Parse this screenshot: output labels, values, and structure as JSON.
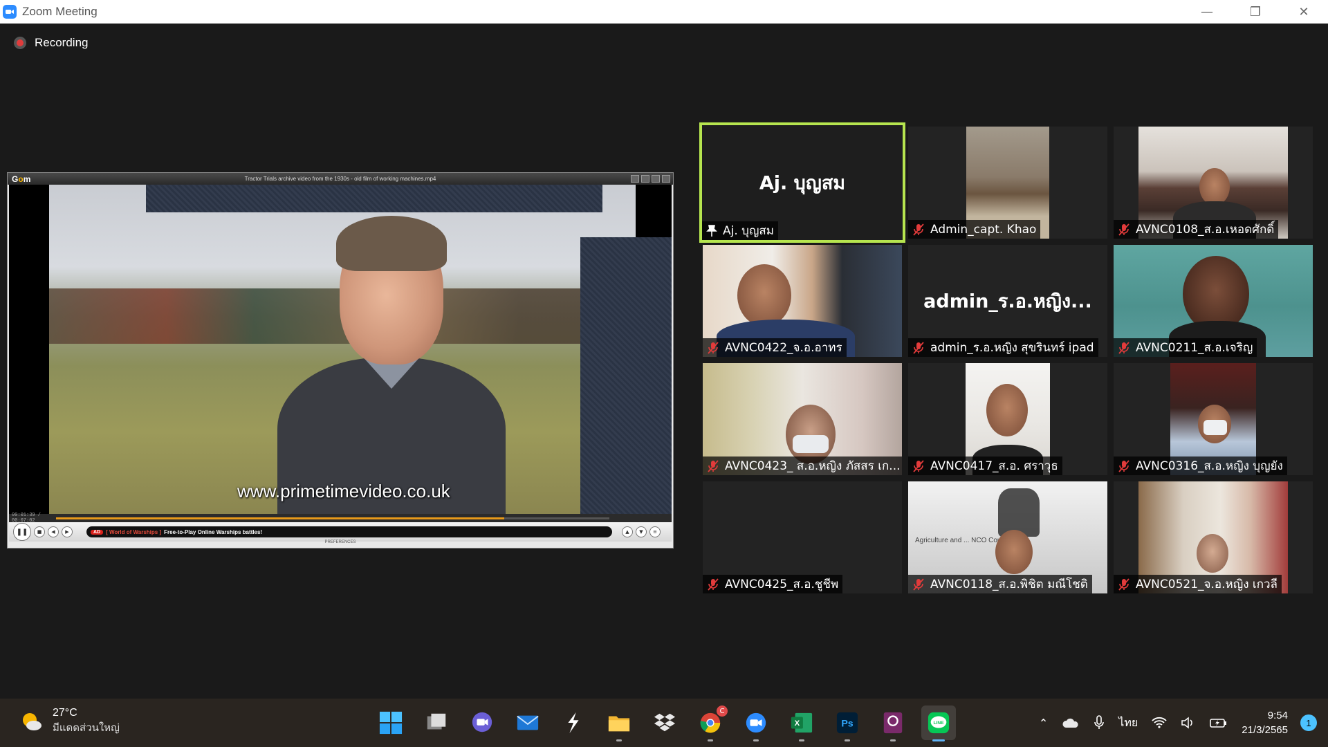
{
  "window": {
    "title": "Zoom Meeting",
    "minimize": "—",
    "restore": "❐",
    "close": "✕"
  },
  "recording": {
    "label": "Recording"
  },
  "shared_screen": {
    "player_logo_a": "G",
    "player_logo_b": "o",
    "player_logo_c": "m",
    "title": "Tractor Trials archive video from the 1930s - old film of working machines.mp4",
    "watermark": "www.primetimevideo.co.uk",
    "time": "00:01:39 / 00:07:02",
    "progress": 0.81,
    "ad_badge": "AD",
    "ad_title": "[ World of Warships ]",
    "ad_text": "Free-to-Play Online Warships battles!",
    "preferences": "PREFERENCES"
  },
  "participants": [
    {
      "display_text": "Aj. บุญสม",
      "name": "Aj. บุญสม",
      "pinned": true,
      "active_speaker": true
    },
    {
      "name": "Admin_capt. Khao",
      "muted": true
    },
    {
      "name": "AVNC0108_ส.อ.เหอดศักดิ์",
      "muted": true
    },
    {
      "name": "AVNC0422_จ.อ.อาทร",
      "muted": true
    },
    {
      "display_text": "admin_ร.อ.หญิง...",
      "name": "admin_ร.อ.หญิง สุขรินทร์ ipad",
      "muted": true
    },
    {
      "name": "AVNC0211_ส.อ.เจริญ",
      "muted": true
    },
    {
      "name": "AVNC0423_ ส.อ.หญิง ภัสสร เก...",
      "muted": true
    },
    {
      "name": "AVNC0417_ส.อ. ศราวุธ",
      "muted": true
    },
    {
      "name": "AVNC0316_ส.อ.หญิง บุญยัง",
      "muted": true
    },
    {
      "name": "AVNC0425_ส.อ.ชูชีพ",
      "muted": true
    },
    {
      "name": "AVNC0118_ส.อ.พิชิต มณีโชติ",
      "muted": true,
      "background_text": "Agriculture and ... NCO Course"
    },
    {
      "name": "AVNC0521_จ.อ.หญิง เกวลี",
      "muted": true
    }
  ],
  "taskbar": {
    "weather": {
      "temp": "27°C",
      "condition": "มีแดดส่วนใหญ่"
    },
    "apps": [
      "start-icon",
      "task-view-icon",
      "chat-icon",
      "mail-icon",
      "app-s-icon",
      "file-explorer-icon",
      "dropbox-icon",
      "chrome-icon",
      "zoom-icon",
      "excel-icon",
      "photoshop-icon",
      "pdf-icon",
      "line-icon"
    ],
    "chrome_badge": "C",
    "tray": {
      "language": "ไทย",
      "time": "9:54",
      "date": "21/3/2565",
      "notifications": "1",
      "chevron": "⌃"
    },
    "line_label": "LINE"
  },
  "colors": {
    "active_speaker_border": "#b6e54f",
    "mute_red": "#e23b3b",
    "taskbar_bg": "#2a2520",
    "accent": "#2d8cff"
  }
}
